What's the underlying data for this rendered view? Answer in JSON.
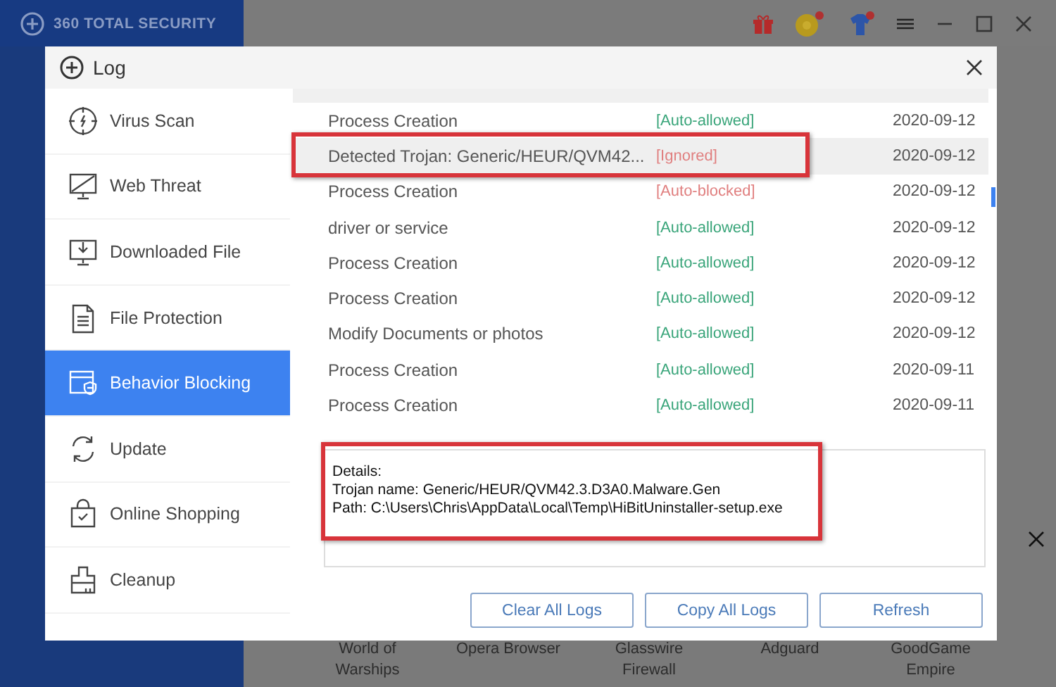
{
  "app": {
    "title": "360 TOTAL SECURITY",
    "games": [
      {
        "label": "World of Warships"
      },
      {
        "label": "Opera Browser"
      },
      {
        "label": "Glasswire Firewall"
      },
      {
        "label": "Adguard"
      },
      {
        "label": "GoodGame Empire"
      }
    ]
  },
  "dialog": {
    "title": "Log"
  },
  "sidebar": {
    "items": [
      {
        "label": "Virus Scan",
        "selected": false
      },
      {
        "label": "Web Threat",
        "selected": false
      },
      {
        "label": "Downloaded File",
        "selected": false
      },
      {
        "label": "File Protection",
        "selected": false
      },
      {
        "label": "Behavior Blocking",
        "selected": true
      },
      {
        "label": "Update",
        "selected": false
      },
      {
        "label": "Online Shopping",
        "selected": false
      },
      {
        "label": "Cleanup",
        "selected": false
      }
    ]
  },
  "log": {
    "rows": [
      {
        "event": "Process Creation",
        "status": "[Auto-allowed]",
        "kind": "allowed",
        "date": "2020-09-12",
        "selected": false,
        "annotated": false
      },
      {
        "event": "Detected Trojan: Generic/HEUR/QVM42...",
        "status": "[Ignored]",
        "kind": "warning",
        "date": "2020-09-12",
        "selected": true,
        "annotated": true
      },
      {
        "event": "Process Creation",
        "status": "[Auto-blocked]",
        "kind": "warning",
        "date": "2020-09-12",
        "selected": false,
        "annotated": false
      },
      {
        "event": "driver or service",
        "status": "[Auto-allowed]",
        "kind": "allowed",
        "date": "2020-09-12",
        "selected": false,
        "annotated": false
      },
      {
        "event": "Process Creation",
        "status": "[Auto-allowed]",
        "kind": "allowed",
        "date": "2020-09-12",
        "selected": false,
        "annotated": false
      },
      {
        "event": "Process Creation",
        "status": "[Auto-allowed]",
        "kind": "allowed",
        "date": "2020-09-12",
        "selected": false,
        "annotated": false
      },
      {
        "event": "Modify Documents or photos",
        "status": "[Auto-allowed]",
        "kind": "allowed",
        "date": "2020-09-12",
        "selected": false,
        "annotated": false
      },
      {
        "event": "Process Creation",
        "status": "[Auto-allowed]",
        "kind": "allowed",
        "date": "2020-09-11",
        "selected": false,
        "annotated": false
      },
      {
        "event": "Process Creation",
        "status": "[Auto-allowed]",
        "kind": "allowed",
        "date": "2020-09-11",
        "selected": false,
        "annotated": false
      }
    ]
  },
  "details": {
    "annotated": true,
    "lines": [
      "Details:",
      "Trojan name: Generic/HEUR/QVM42.3.D3A0.Malware.Gen",
      "Path: C:\\Users\\Chris\\AppData\\Local\\Temp\\HiBitUninstaller-setup.exe"
    ]
  },
  "buttons": [
    "Clear All Logs",
    "Copy All Logs",
    "Refresh"
  ]
}
